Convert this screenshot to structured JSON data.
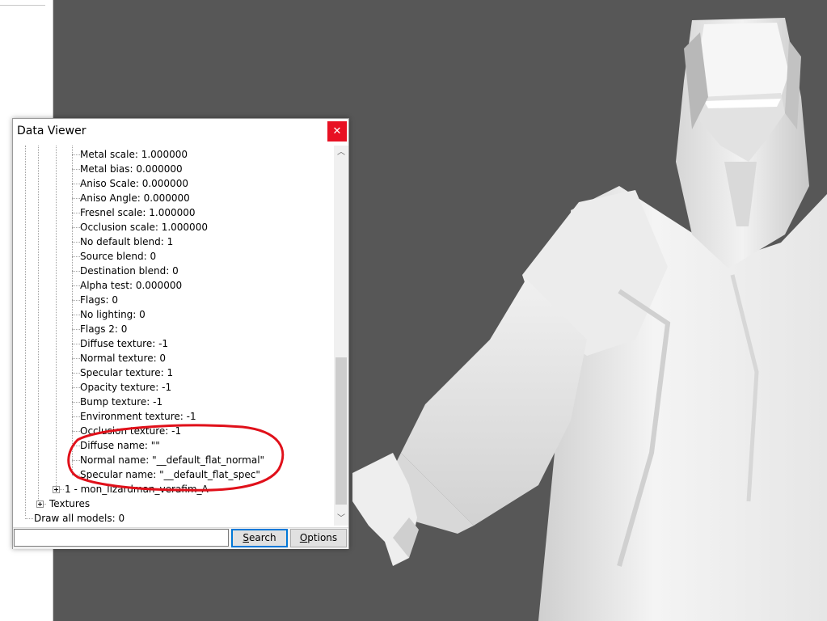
{
  "dialog": {
    "title": "Data Viewer",
    "close_glyph": "✕"
  },
  "tree": {
    "properties": [
      "Metal scale: 1.000000",
      "Metal bias: 0.000000",
      "Aniso Scale: 0.000000",
      "Aniso Angle: 0.000000",
      "Fresnel scale: 1.000000",
      "Occlusion scale: 1.000000",
      "No default blend: 1",
      "Source blend: 0",
      "Destination blend: 0",
      "Alpha test: 0.000000",
      "Flags: 0",
      "No lighting: 0",
      "Flags 2: 0",
      "Diffuse texture: -1",
      "Normal texture: 0",
      "Specular texture: 1",
      "Opacity texture: -1",
      "Bump texture: -1",
      "Environment texture: -1",
      "Occlusion texture: -1",
      "Diffuse name: \"\"",
      "Normal name: \"__default_flat_normal\"",
      "Specular name: \"__default_flat_spec\""
    ],
    "model_node": "1 - mon_lizardman_verafim_A",
    "textures_node": "Textures",
    "draw_all_models": "Draw all models: 0"
  },
  "bottom_bar": {
    "search_value": "",
    "search_button": "Search",
    "options_button": "Options"
  },
  "colors": {
    "viewport_bg": "#575757",
    "annotation_red": "#e0101a",
    "close_red": "#e81123",
    "focus_blue": "#0078d7"
  },
  "icons": {
    "close": "close-icon",
    "scroll_up": "chevron-up-icon",
    "scroll_down": "chevron-down-icon",
    "expand": "plus-box-icon"
  }
}
